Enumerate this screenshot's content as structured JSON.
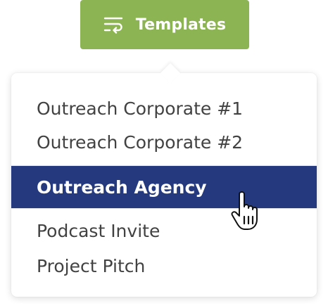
{
  "templates_button": {
    "label": "Templates",
    "icon": "templates-list-icon",
    "color": "#8db452"
  },
  "menu": {
    "items": [
      {
        "label": "Outreach Corporate #1",
        "active": false
      },
      {
        "label": "Outreach Corporate #2",
        "active": false
      },
      {
        "label": "Outreach Agency",
        "active": true
      },
      {
        "label": "Podcast Invite",
        "active": false
      },
      {
        "label": "Project Pitch",
        "active": false
      }
    ],
    "active_color": "#253a7e"
  },
  "cursor": {
    "icon": "hand-pointer-icon"
  }
}
